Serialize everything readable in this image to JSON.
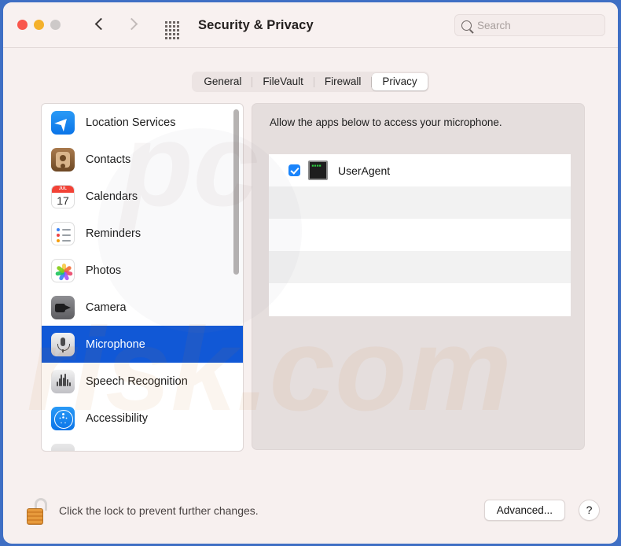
{
  "window": {
    "title": "Security & Privacy",
    "traffic_lights": [
      "close-red",
      "minimize-yellow",
      "zoom-grey"
    ],
    "nav": {
      "back": "back-chevron",
      "forward": "forward-chevron"
    },
    "grid_icon": "show-all-icon",
    "accent_blue": "#1158d6",
    "border_blue": "#3f6fc4"
  },
  "search": {
    "placeholder": "Search",
    "value": "",
    "icon": "search-icon"
  },
  "tabs": [
    {
      "label": "General",
      "active": false
    },
    {
      "label": "FileVault",
      "active": false
    },
    {
      "label": "Firewall",
      "active": false
    },
    {
      "label": "Privacy",
      "active": true
    }
  ],
  "sidebar": {
    "items": [
      {
        "label": "Location Services",
        "icon": "location-services-icon",
        "selected": false
      },
      {
        "label": "Contacts",
        "icon": "contacts-icon",
        "selected": false
      },
      {
        "label": "Calendars",
        "icon": "calendars-icon",
        "selected": false,
        "icon_month": "JUL",
        "icon_day": "17"
      },
      {
        "label": "Reminders",
        "icon": "reminders-icon",
        "selected": false
      },
      {
        "label": "Photos",
        "icon": "photos-icon",
        "selected": false
      },
      {
        "label": "Camera",
        "icon": "camera-icon",
        "selected": false
      },
      {
        "label": "Microphone",
        "icon": "microphone-icon",
        "selected": true
      },
      {
        "label": "Speech Recognition",
        "icon": "speech-recognition-icon",
        "selected": false
      },
      {
        "label": "Accessibility",
        "icon": "accessibility-icon",
        "selected": false
      }
    ],
    "scrollbar": "vertical-scrollbar"
  },
  "pane": {
    "heading": "Allow the apps below to access your microphone.",
    "apps": [
      {
        "name": "UserAgent",
        "checked": true,
        "icon": "terminal-app-icon",
        "icon_text": "■■■■"
      }
    ]
  },
  "footer": {
    "lock_icon": "unlocked-padlock-icon",
    "lock_text": "Click the lock to prevent further changes.",
    "advanced_label": "Advanced...",
    "help_label": "?"
  },
  "watermark": {
    "line1": "pc",
    "line2": "risk.com"
  }
}
